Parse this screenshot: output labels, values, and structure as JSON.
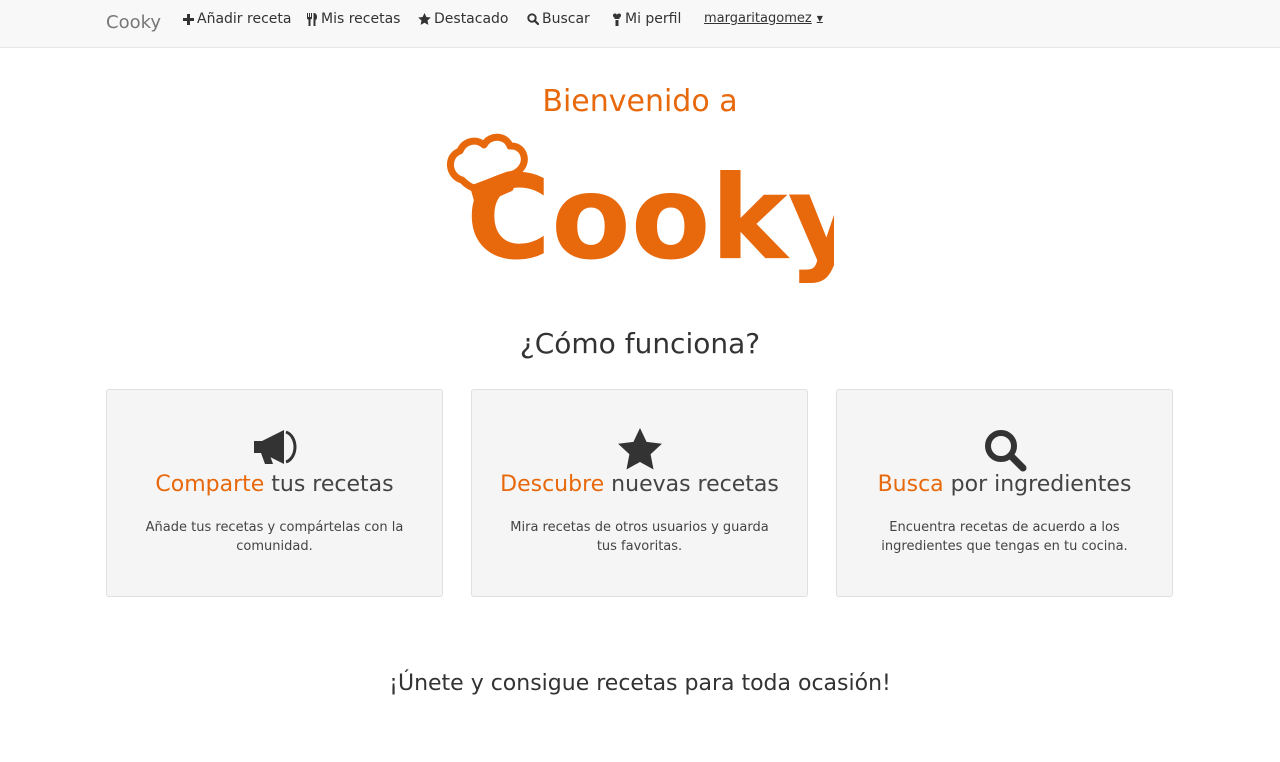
{
  "navbar": {
    "brand": "Cooky",
    "items": [
      {
        "label": "Añadir receta",
        "icon": "plus-icon"
      },
      {
        "label": "Mis recetas",
        "icon": "cutlery-icon"
      },
      {
        "label": "Destacado",
        "icon": "star-icon"
      },
      {
        "label": "Buscar",
        "icon": "search-icon"
      },
      {
        "label": "Mi perfil",
        "icon": "chef-icon"
      }
    ],
    "user": "margaritagomez"
  },
  "hero": {
    "welcome": "Bienvenido a",
    "logo_text": "Cooky."
  },
  "how": {
    "title": "¿Cómo funciona?",
    "cards": [
      {
        "accent": "Comparte",
        "rest": " tus recetas",
        "desc": "Añade tus recetas y compártelas con la comunidad.",
        "icon": "megaphone-icon"
      },
      {
        "accent": "Descubre",
        "rest": " nuevas recetas",
        "desc": "Mira recetas de otros usuarios y guarda tus favoritas.",
        "icon": "star-icon"
      },
      {
        "accent": "Busca",
        "rest": " por ingredientes",
        "desc": "Encuentra recetas de acuerdo a los ingredientes que tengas en tu cocina.",
        "icon": "search-icon"
      }
    ]
  },
  "footer_cta": "¡Únete y consigue recetas para toda ocasión!",
  "colors": {
    "accent": "#e8680c",
    "text": "#333333",
    "card_bg": "#f5f5f5"
  }
}
